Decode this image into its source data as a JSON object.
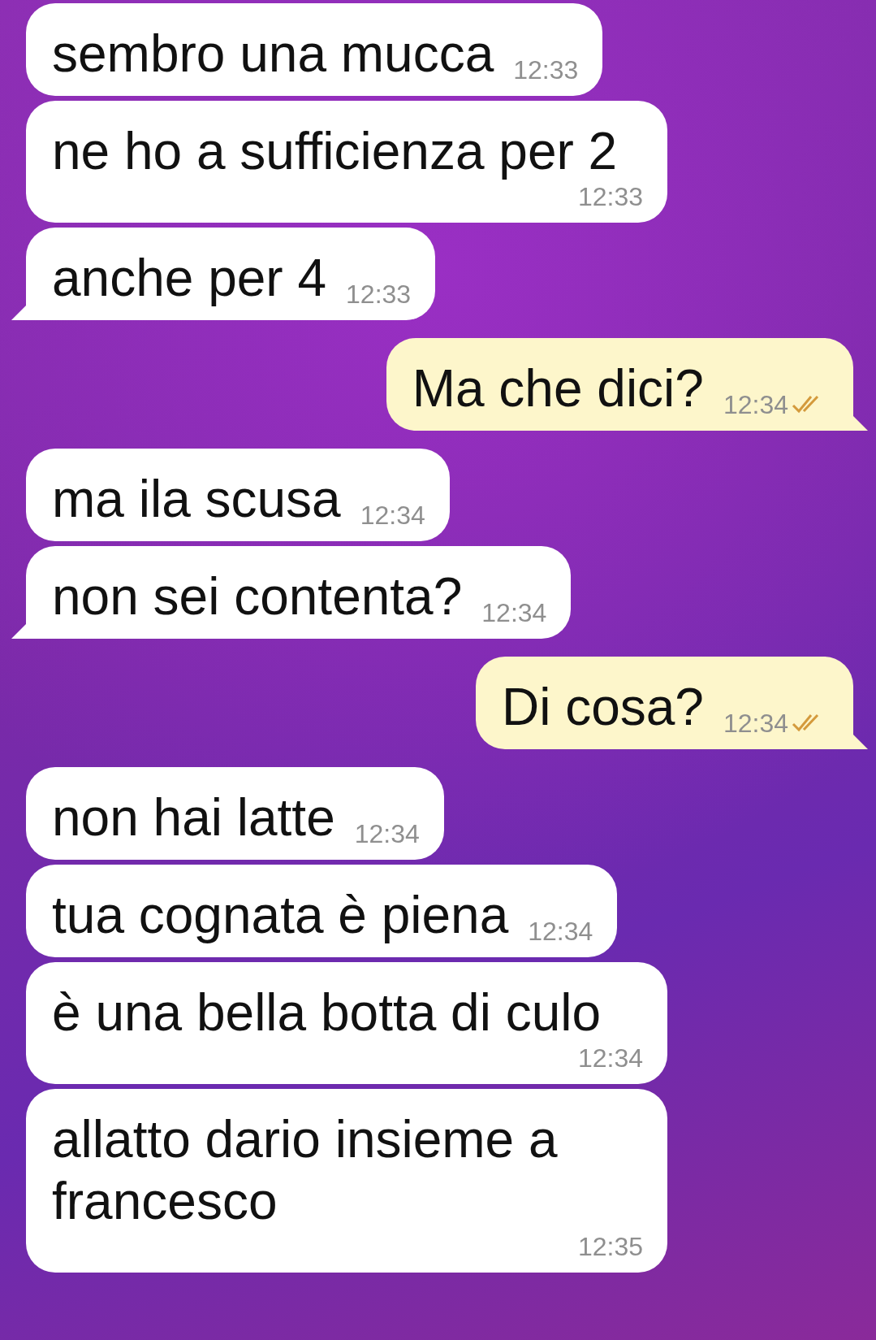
{
  "messages": [
    {
      "kind": "incoming",
      "text": "sembro una mucca",
      "time": "12:33",
      "tail": false,
      "ticks": false
    },
    {
      "kind": "incoming",
      "text": "ne ho a sufficienza per 2",
      "time": "12:33",
      "tail": false,
      "ticks": false
    },
    {
      "kind": "incoming",
      "text": "anche per 4",
      "time": "12:33",
      "tail": true,
      "ticks": false
    },
    {
      "kind": "outgoing",
      "text": "Ma che dici?",
      "time": "12:34",
      "tail": true,
      "ticks": true
    },
    {
      "kind": "incoming",
      "text": "ma ila scusa",
      "time": "12:34",
      "tail": false,
      "ticks": false
    },
    {
      "kind": "incoming",
      "text": "non sei contenta?",
      "time": "12:34",
      "tail": true,
      "ticks": false
    },
    {
      "kind": "outgoing",
      "text": "Di cosa?",
      "time": "12:34",
      "tail": true,
      "ticks": true
    },
    {
      "kind": "incoming",
      "text": "non hai latte",
      "time": "12:34",
      "tail": false,
      "ticks": false
    },
    {
      "kind": "incoming",
      "text": "tua cognata è piena",
      "time": "12:34",
      "tail": false,
      "ticks": false
    },
    {
      "kind": "incoming",
      "text": "è una bella botta di culo",
      "time": "12:34",
      "tail": false,
      "ticks": false
    },
    {
      "kind": "incoming",
      "text": "allatto dario insieme a francesco",
      "time": "12:35",
      "tail": false,
      "ticks": false
    }
  ]
}
